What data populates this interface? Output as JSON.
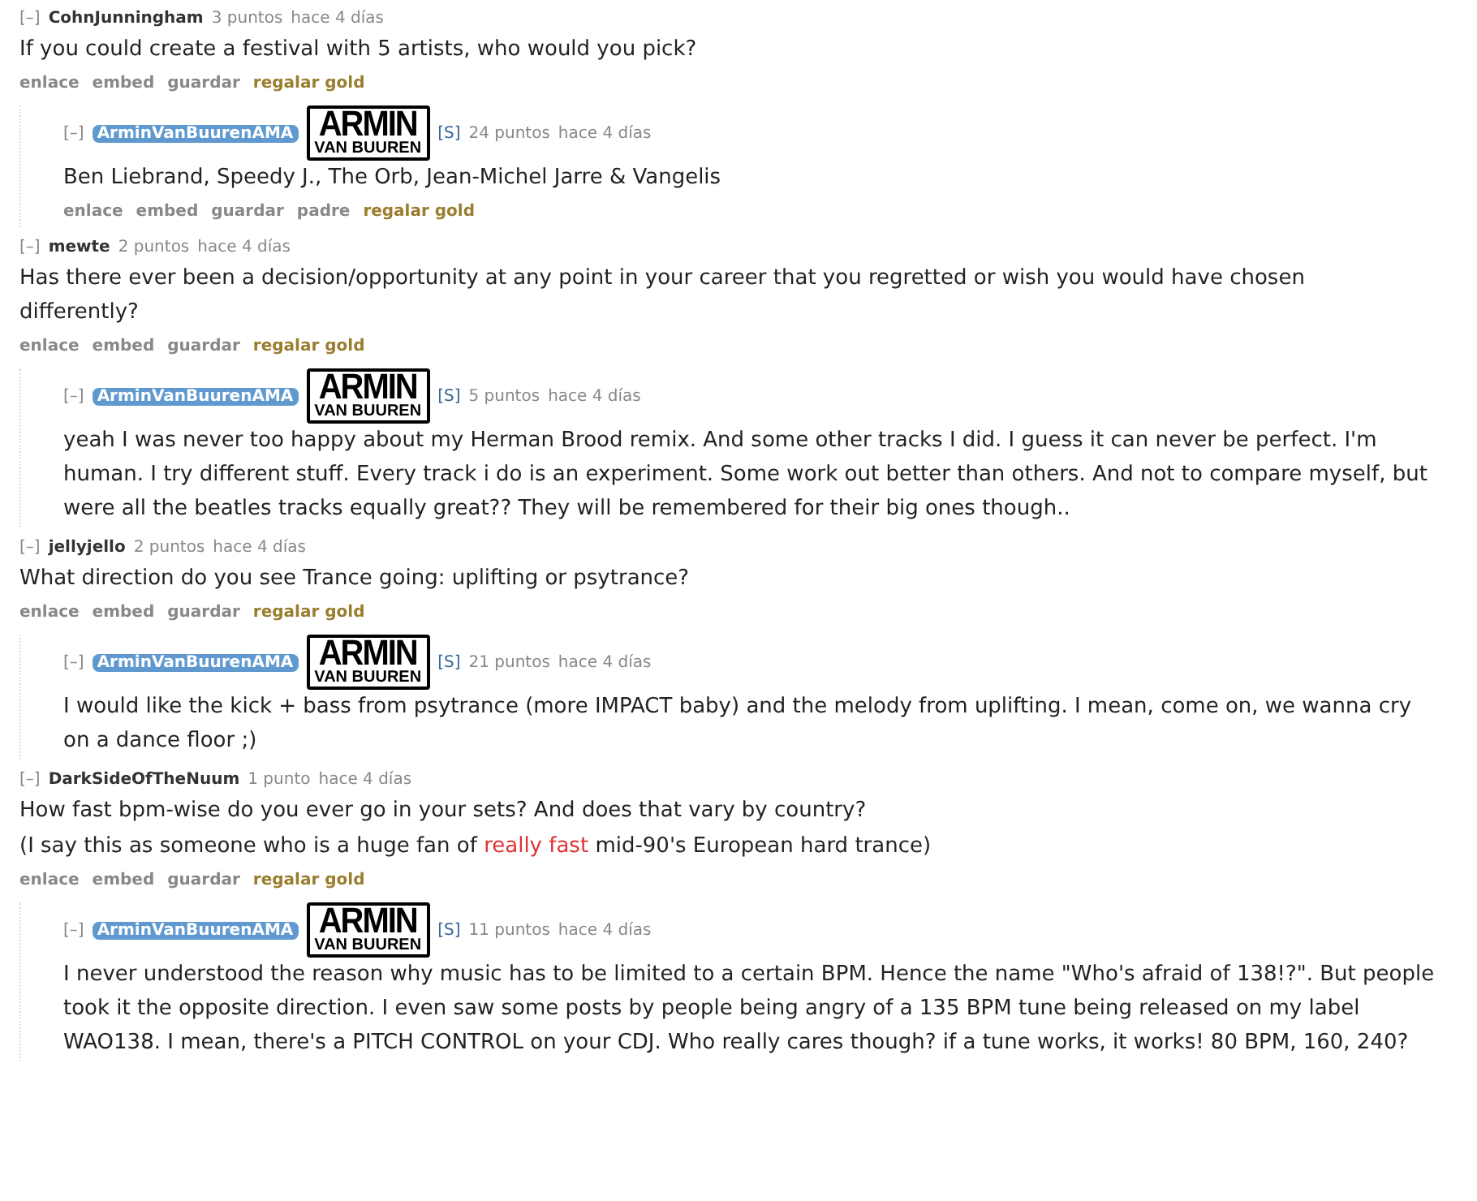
{
  "threads": [
    {
      "comment": {
        "collapse": "[–]",
        "author": "CohnJunningham",
        "submitter": false,
        "score": "3 puntos",
        "time": "hace 4 días",
        "paragraphs": [
          [
            {
              "kind": "text",
              "text": "If you could create a festival with 5 artists, who would you pick?"
            }
          ]
        ],
        "actions": [
          {
            "label": "enlace",
            "kind": "plain"
          },
          {
            "label": "embed",
            "kind": "plain"
          },
          {
            "label": "guardar",
            "kind": "plain"
          },
          {
            "label": "regalar gold",
            "kind": "gold"
          }
        ]
      },
      "reply": {
        "collapse": "[–]",
        "author": "ArminVanBuurenAMA",
        "submitter": true,
        "flair": [
          "ARMIN",
          "VAN BUUREN"
        ],
        "tag": "[S]",
        "score": "24 puntos",
        "time": "hace 4 días",
        "paragraphs": [
          [
            {
              "kind": "text",
              "text": "Ben Liebrand, Speedy J., The Orb, Jean-Michel Jarre & Vangelis"
            }
          ]
        ],
        "actions": [
          {
            "label": "enlace",
            "kind": "plain"
          },
          {
            "label": "embed",
            "kind": "plain"
          },
          {
            "label": "guardar",
            "kind": "plain"
          },
          {
            "label": "padre",
            "kind": "plain"
          },
          {
            "label": "regalar gold",
            "kind": "gold"
          }
        ]
      }
    },
    {
      "comment": {
        "collapse": "[–]",
        "author": "mewte",
        "submitter": false,
        "score": "2 puntos",
        "time": "hace 4 días",
        "paragraphs": [
          [
            {
              "kind": "text",
              "text": "Has there ever been a decision/opportunity at any point in your career that you regretted or wish you would have chosen differently?"
            }
          ]
        ],
        "actions": [
          {
            "label": "enlace",
            "kind": "plain"
          },
          {
            "label": "embed",
            "kind": "plain"
          },
          {
            "label": "guardar",
            "kind": "plain"
          },
          {
            "label": "regalar gold",
            "kind": "gold"
          }
        ]
      },
      "reply": {
        "collapse": "[–]",
        "author": "ArminVanBuurenAMA",
        "submitter": true,
        "flair": [
          "ARMIN",
          "VAN BUUREN"
        ],
        "tag": "[S]",
        "score": "5 puntos",
        "time": "hace 4 días",
        "paragraphs": [
          [
            {
              "kind": "text",
              "text": "yeah I was never too happy about my Herman Brood remix. And some other tracks I did. I guess it can never be perfect. I'm human. I try different stuff. Every track i do is an experiment. Some work out better than others. And not to compare myself, but were all the beatles tracks equally great?? They will be remembered for their big ones though.."
            }
          ]
        ]
      }
    },
    {
      "comment": {
        "collapse": "[–]",
        "author": "jellyjello",
        "submitter": false,
        "score": "2 puntos",
        "time": "hace 4 días",
        "paragraphs": [
          [
            {
              "kind": "text",
              "text": "What direction do you see Trance going: uplifting or psytrance?"
            }
          ]
        ],
        "actions": [
          {
            "label": "enlace",
            "kind": "plain"
          },
          {
            "label": "embed",
            "kind": "plain"
          },
          {
            "label": "guardar",
            "kind": "plain"
          },
          {
            "label": "regalar gold",
            "kind": "gold"
          }
        ]
      },
      "reply": {
        "collapse": "[–]",
        "author": "ArminVanBuurenAMA",
        "submitter": true,
        "flair": [
          "ARMIN",
          "VAN BUUREN"
        ],
        "tag": "[S]",
        "score": "21 puntos",
        "time": "hace 4 días",
        "paragraphs": [
          [
            {
              "kind": "text",
              "text": "I would like the kick + bass from psytrance (more IMPACT baby) and the melody from uplifting. I mean, come on, we wanna cry on a dance floor ;)"
            }
          ]
        ]
      }
    },
    {
      "comment": {
        "collapse": "[–]",
        "author": "DarkSideOfTheNuum",
        "submitter": false,
        "score": "1 punto",
        "time": "hace 4 días",
        "paragraphs": [
          [
            {
              "kind": "text",
              "text": "How fast bpm-wise do you ever go in your sets? And does that vary by country?"
            }
          ],
          [
            {
              "kind": "text",
              "text": "(I say this as someone who is a huge fan of "
            },
            {
              "kind": "link",
              "text": "really fast"
            },
            {
              "kind": "text",
              "text": " mid-90's European hard trance)"
            }
          ]
        ],
        "actions": [
          {
            "label": "enlace",
            "kind": "plain"
          },
          {
            "label": "embed",
            "kind": "plain"
          },
          {
            "label": "guardar",
            "kind": "plain"
          },
          {
            "label": "regalar gold",
            "kind": "gold"
          }
        ]
      },
      "reply": {
        "collapse": "[–]",
        "author": "ArminVanBuurenAMA",
        "submitter": true,
        "flair": [
          "ARMIN",
          "VAN BUUREN"
        ],
        "tag": "[S]",
        "score": "11 puntos",
        "time": "hace 4 días",
        "paragraphs": [
          [
            {
              "kind": "text",
              "text": "I never understood the reason why music has to be limited to a certain BPM. Hence the name \"Who's afraid of 138!?\". But people took it the opposite direction. I even saw some posts by people being angry of a 135 BPM tune being released on my label WAO138. I mean, there's a PITCH CONTROL on your CDJ. Who really cares though? if a tune works, it works! 80 BPM, 160, 240?"
            }
          ]
        ]
      }
    }
  ]
}
